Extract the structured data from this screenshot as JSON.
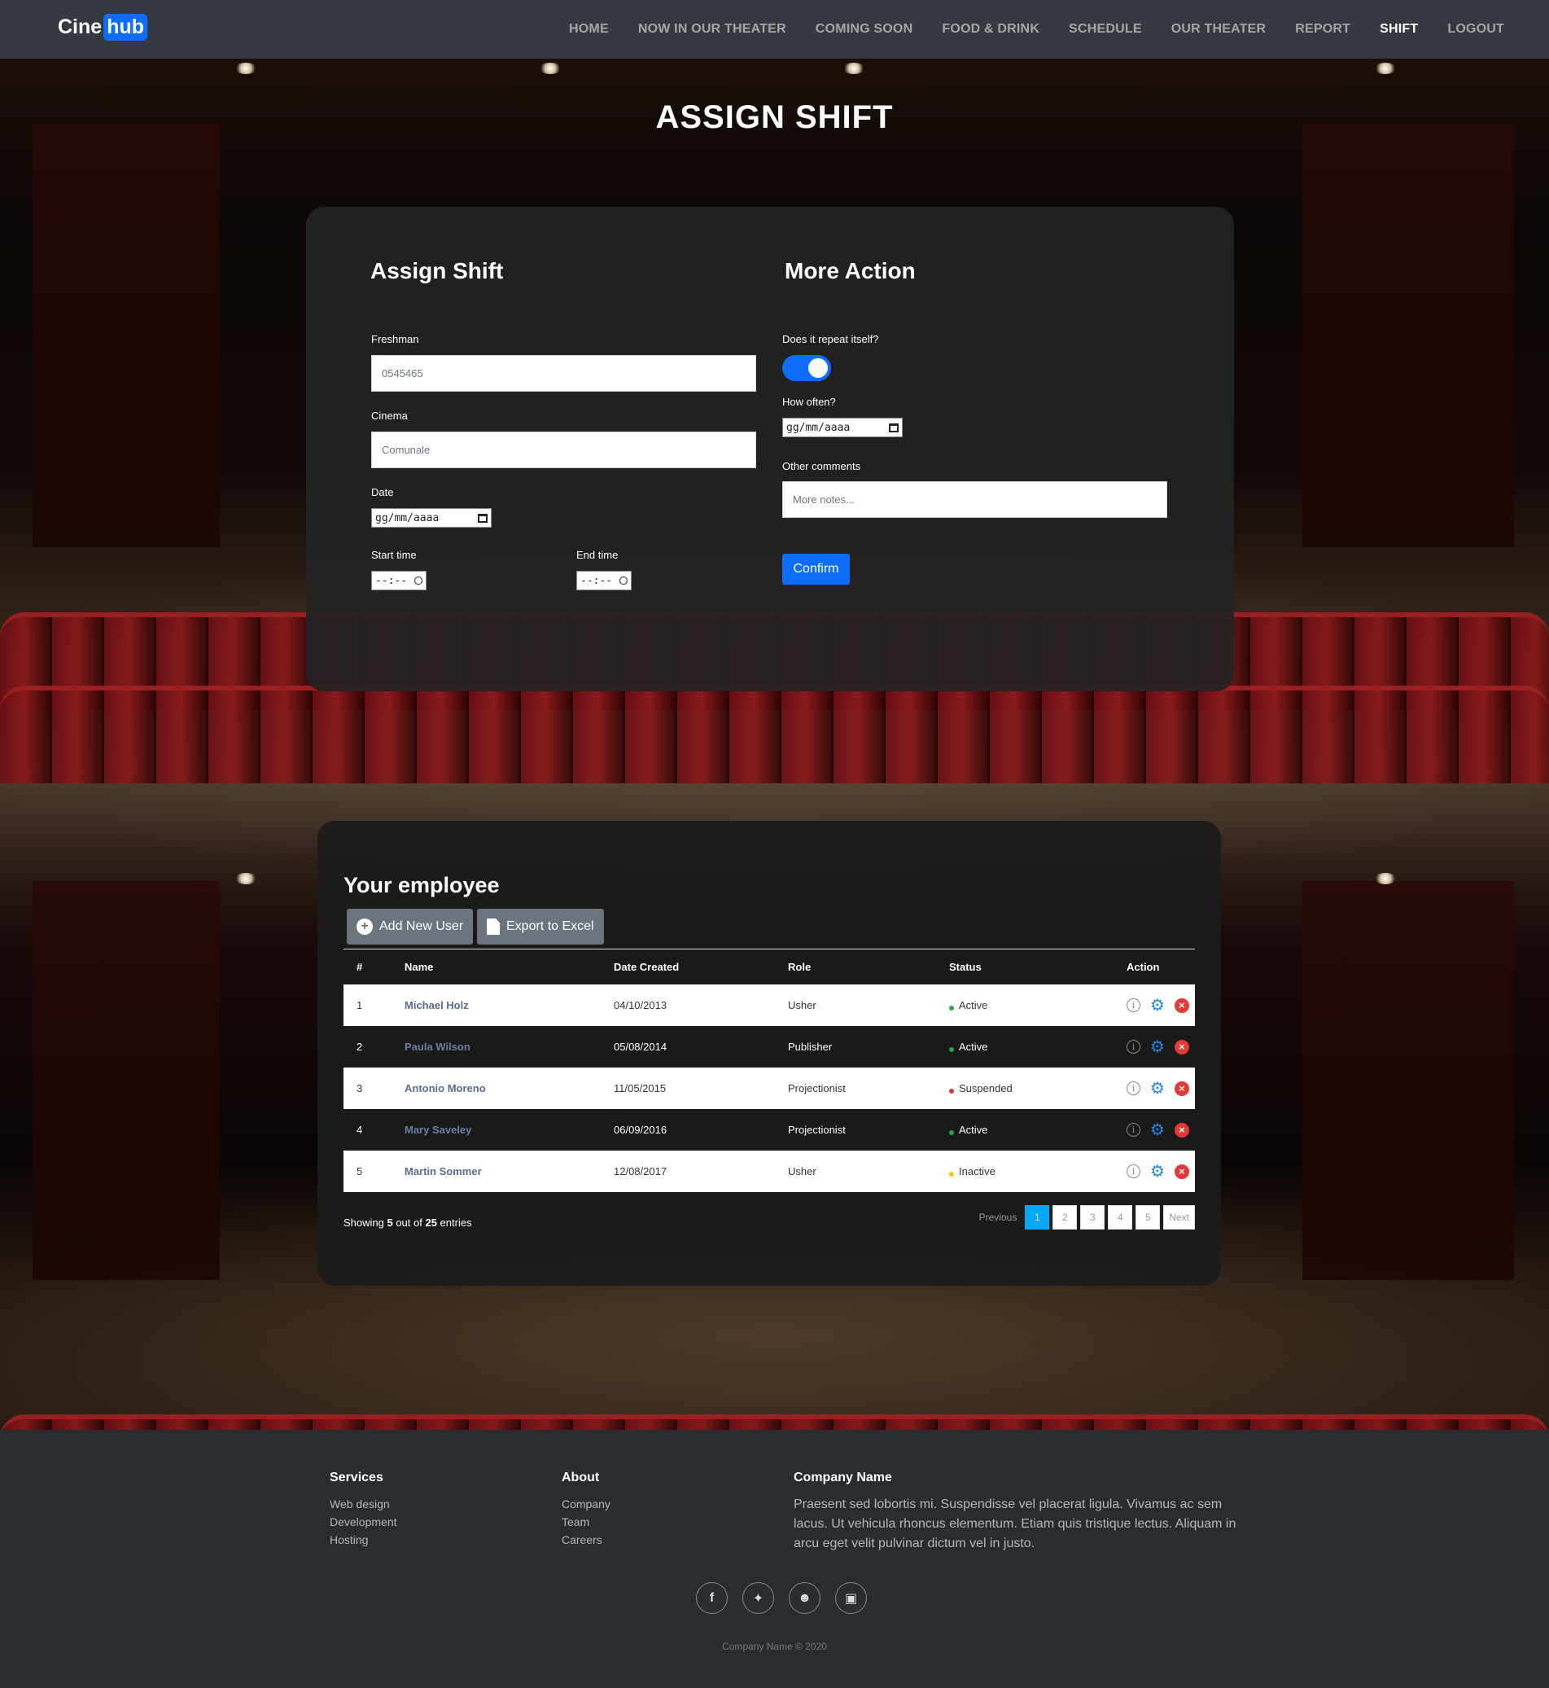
{
  "brand": {
    "part1": "Cine",
    "part2": "hub"
  },
  "nav": [
    {
      "label": "HOME",
      "active": false
    },
    {
      "label": "NOW IN OUR THEATER",
      "active": false
    },
    {
      "label": "COMING SOON",
      "active": false
    },
    {
      "label": "FOOD & DRINK",
      "active": false
    },
    {
      "label": "SCHEDULE",
      "active": false
    },
    {
      "label": "OUR THEATER",
      "active": false
    },
    {
      "label": "REPORT",
      "active": false
    },
    {
      "label": "SHIFT",
      "active": true
    },
    {
      "label": "LOGOUT",
      "active": false
    }
  ],
  "page_title": "ASSIGN SHIFT",
  "assign": {
    "title": "Assign Shift",
    "freshman_label": "Freshman",
    "freshman_placeholder": "0545465",
    "cinema_label": "Cinema",
    "cinema_placeholder": "Comunale",
    "date_label": "Date",
    "date_placeholder": "gg/mm/aaaa",
    "start_label": "Start time",
    "end_label": "End time",
    "time_placeholder": "--:--"
  },
  "more": {
    "title": "More Action",
    "repeat_label": "Does it repeat itself?",
    "repeat_on": true,
    "often_label": "How often?",
    "often_placeholder": "gg/mm/aaaa",
    "comments_label": "Other comments",
    "comments_placeholder": "More notes...",
    "confirm": "Confirm"
  },
  "employees": {
    "title": "Your employee",
    "add_btn": "Add New User",
    "export_btn": "Export to Excel",
    "columns": [
      "#",
      "Name",
      "Date Created",
      "Role",
      "Status",
      "Action"
    ],
    "rows": [
      {
        "num": "1",
        "name": "Michael Holz",
        "date": "04/10/2013",
        "role": "Usher",
        "status": "Active",
        "status_color": "#28a745"
      },
      {
        "num": "2",
        "name": "Paula Wilson",
        "date": "05/08/2014",
        "role": "Publisher",
        "status": "Active",
        "status_color": "#28a745"
      },
      {
        "num": "3",
        "name": "Antonio Moreno",
        "date": "11/05/2015",
        "role": "Projectionist",
        "status": "Suspended",
        "status_color": "#dc3545"
      },
      {
        "num": "4",
        "name": "Mary Saveley",
        "date": "06/09/2016",
        "role": "Projectionist",
        "status": "Active",
        "status_color": "#28a745"
      },
      {
        "num": "5",
        "name": "Martin Sommer",
        "date": "12/08/2017",
        "role": "Usher",
        "status": "Inactive",
        "status_color": "#ffc107"
      }
    ],
    "showing_prefix": "Showing ",
    "showing_count": "5",
    "showing_mid": " out of ",
    "showing_total": "25",
    "showing_suffix": " entries",
    "pager": {
      "prev": "Previous",
      "pages": [
        "1",
        "2",
        "3",
        "4",
        "5"
      ],
      "active": "1",
      "next": "Next"
    }
  },
  "footer": {
    "services_title": "Services",
    "services": [
      "Web design",
      "Development",
      "Hosting"
    ],
    "about_title": "About",
    "about": [
      "Company",
      "Team",
      "Careers"
    ],
    "company_title": "Company Name",
    "company_text": "Praesent sed lobortis mi. Suspendisse vel placerat ligula. Vivamus ac sem lacus. Ut vehicula rhoncus elementum. Etiam quis tristique lectus. Aliquam in arcu eget velit pulvinar dictum vel in justo.",
    "socials": [
      "facebook-icon",
      "twitter-icon",
      "snapchat-icon",
      "instagram-icon"
    ],
    "copyright": "Company Name © 2020"
  },
  "colors": {
    "accent": "#0d6efd",
    "pager_active": "#03a9f4",
    "gear": "#1e88e5",
    "delete": "#e53935"
  }
}
